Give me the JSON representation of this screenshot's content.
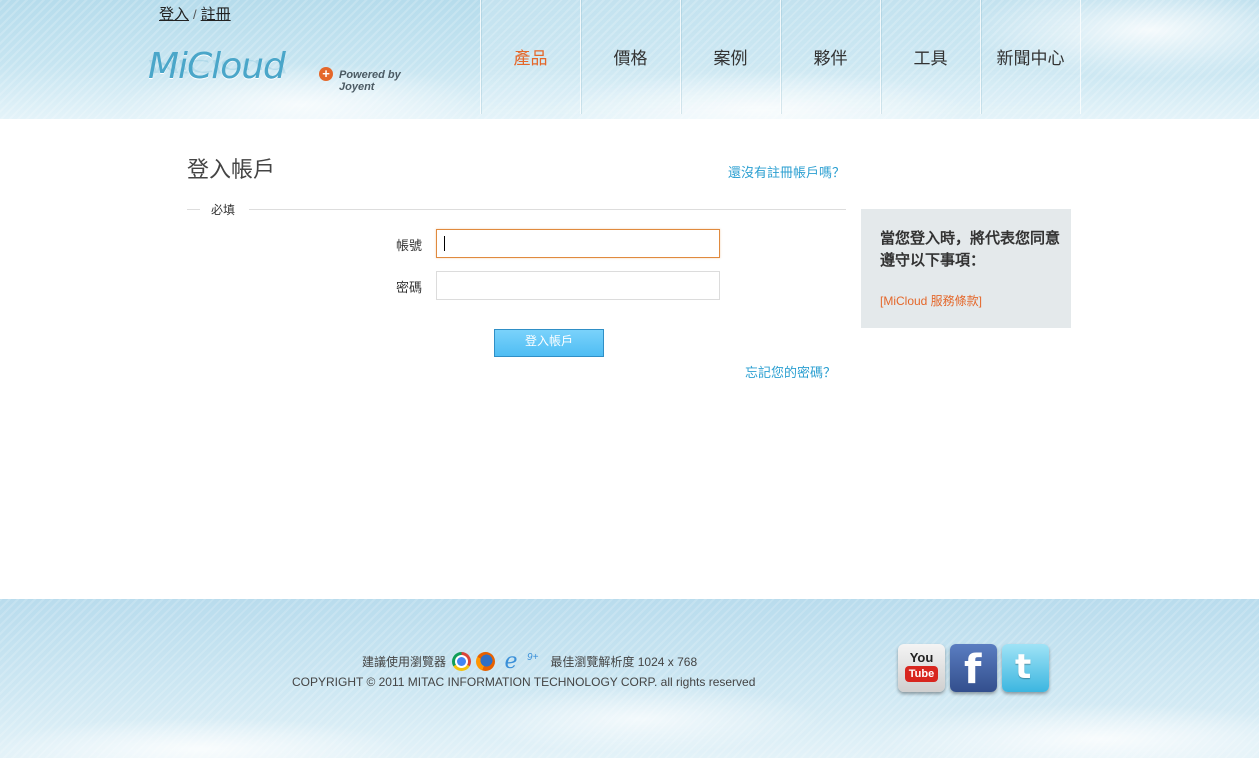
{
  "header": {
    "top_links": {
      "login": "登入",
      "separator": "/",
      "register": "註冊"
    },
    "logo": {
      "text": "MiCloud",
      "powered_by": "Powered by Joyent"
    },
    "nav": [
      {
        "label": "產品",
        "active": true
      },
      {
        "label": "價格"
      },
      {
        "label": "案例"
      },
      {
        "label": "夥伴"
      },
      {
        "label": "工具"
      },
      {
        "label": "新聞中心"
      }
    ]
  },
  "main": {
    "title": "登入帳戶",
    "register_prompt": "還沒有註冊帳戶嗎？",
    "required_legend": "必填",
    "fields": {
      "account_label": "帳號",
      "account_value": "",
      "password_label": "密碼",
      "password_value": ""
    },
    "login_button": "登入帳戶",
    "forgot_password": "忘記您的密碼？"
  },
  "terms": {
    "heading": "當您登入時，將代表您同意遵守以下事項：",
    "link": "[MiCloud 服務條款]"
  },
  "footer": {
    "browser_prefix": "建議使用瀏覽器",
    "ie_version": "9+",
    "resolution_text": "最佳瀏覽解析度 1024 x 768",
    "copyright": "COPYRIGHT © 2011 MITAC INFORMATION TECHNOLOGY CORP. all rights reserved",
    "social": [
      {
        "icon": "youtube-icon",
        "top": "You",
        "bottom": "Tube"
      },
      {
        "icon": "facebook-icon",
        "glyph": "f"
      },
      {
        "icon": "twitter-icon",
        "glyph": "t"
      }
    ]
  },
  "colors": {
    "accent_orange": "#e4672a",
    "link_blue": "#2b9fd1",
    "button_blue": "#4fbdf3"
  }
}
